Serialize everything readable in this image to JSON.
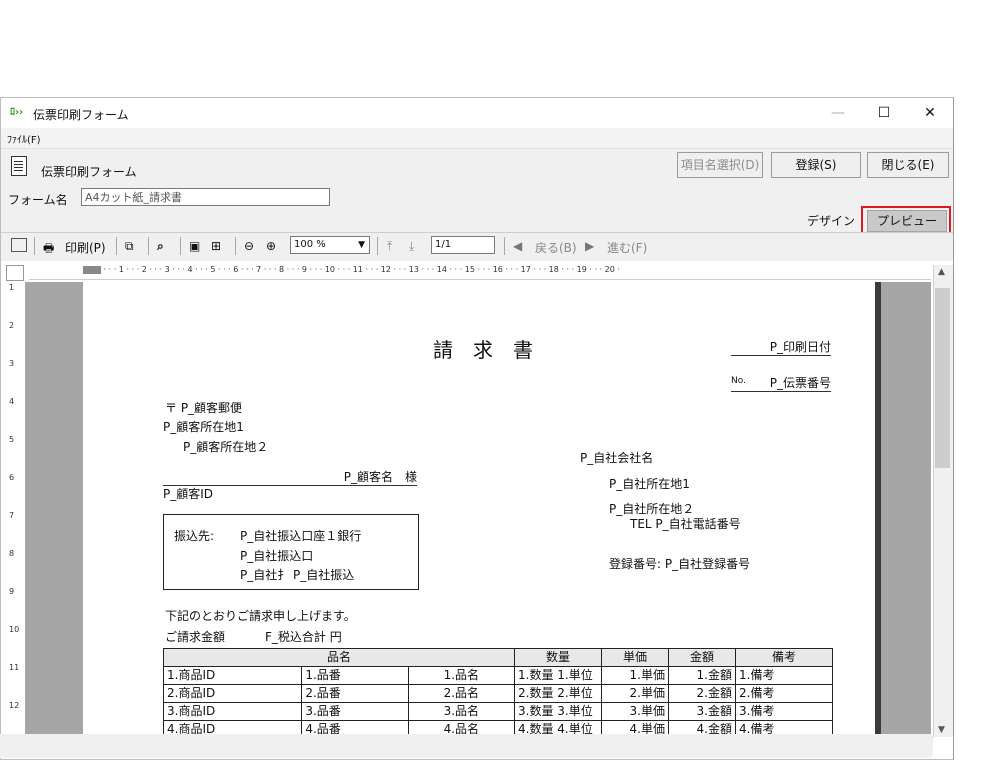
{
  "window": {
    "title": "伝票印刷フォーム",
    "app_icon": "ﾛ››",
    "minimize": "—",
    "maximize": "☐",
    "close": "✕"
  },
  "menu": {
    "file": "ﾌｧｲﾙ(F)"
  },
  "form_header": {
    "title": "伝票印刷フォーム",
    "item_select_label": "項目名選択(D)",
    "register_label": "登録(S)",
    "close_label": "閉じる(E)"
  },
  "form_name": {
    "label": "フォーム名",
    "value": "A4カット紙_請求書"
  },
  "tabs": {
    "design": "デザイン",
    "preview": "プレビュー"
  },
  "toolbar": {
    "print_label": "印刷(P)",
    "zoom_value": "100 %",
    "page_value": "1/1",
    "back_label": "戻る(B)",
    "forward_label": "進む(F)"
  },
  "ruler": {
    "top": "· · · 1 · · · 2 · · · 3 · · · 4 · · · 5 · · · 6 · · · 7 · · · 8 · · · 9 · · · 10 · · · 11 · · · 12 · · · 13 · · · 14 · · · 15 · · · 16 · · · 17 · · · 18 · · · 19 · · · 20 ·",
    "left": [
      "1",
      "2",
      "3",
      "4",
      "5",
      "6",
      "7",
      "8",
      "9",
      "10",
      "11",
      "12"
    ]
  },
  "invoice": {
    "title": "請　求　書",
    "print_date": "P_印刷日付",
    "no_label": "No.",
    "slip_no": "P_伝票番号",
    "customer_postal": "〒 P_顧客郵便",
    "customer_addr1": "P_顧客所在地1",
    "customer_addr2": "P_顧客所在地２",
    "customer_name": "P_顧客名　様",
    "customer_id": "P_顧客ID",
    "company_name": "P_自社会社名",
    "company_addr1": "P_自社所在地1",
    "company_addr2": "P_自社所在地２",
    "company_tel": "TEL P_自社電話番号",
    "reg_no": "登録番号:  P_自社登録番号",
    "bank_label": "振込先:",
    "bank_line1": "P_自社振込口座１銀行",
    "bank_line2": "P_自社振込口",
    "bank_line3": "P_自社扌 P_自社振込",
    "intro": "下記のとおりご請求申し上げます。",
    "amount_label": "ご請求金額",
    "amount_value": "F_税込合計 円",
    "table_headers": [
      "品名",
      "数量",
      "単価",
      "金額",
      "備考"
    ],
    "rows": [
      [
        "1.商品ID",
        "1.品番",
        "1.品名",
        "1.数量 1.単位",
        "1.単価",
        "1.金額",
        "1.備考"
      ],
      [
        "2.商品ID",
        "2.品番",
        "2.品名",
        "2.数量 2.単位",
        "2.単価",
        "2.金額",
        "2.備考"
      ],
      [
        "3.商品ID",
        "3.品番",
        "3.品名",
        "3.数量 3.単位",
        "3.単価",
        "3.金額",
        "3.備考"
      ],
      [
        "4.商品ID",
        "4.品番",
        "4.品名",
        "4.数量 4.単位",
        "4.単価",
        "4.金額",
        "4.備考"
      ]
    ]
  },
  "colors": {
    "highlight": "#d81b24",
    "canvas": "#a6a6a6",
    "app_icon": "#2f9e1e"
  }
}
